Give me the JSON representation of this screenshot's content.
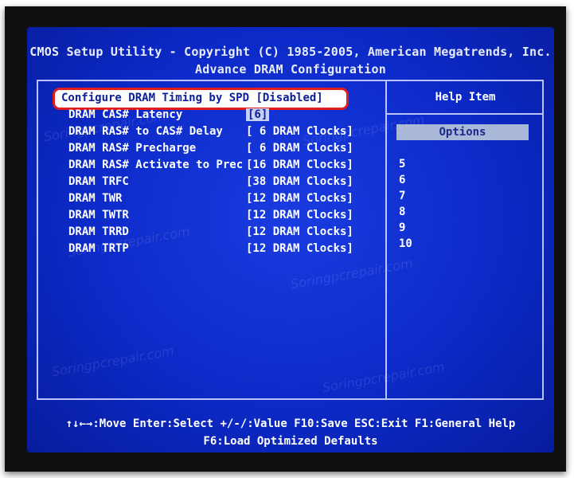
{
  "header": {
    "title_line1": "CMOS Setup Utility - Copyright (C) 1985-2005, American Megatrends, Inc.",
    "title_line2": "Advance DRAM Configuration"
  },
  "selected_setting": {
    "label": "Configure DRAM Timing by SPD",
    "value": "[Disabled]"
  },
  "settings": [
    {
      "name": "DRAM CAS# Latency",
      "value": "[6]"
    },
    {
      "name": "DRAM RAS# to CAS# Delay",
      "value": "[ 6 DRAM Clocks]"
    },
    {
      "name": "DRAM RAS# Precharge",
      "value": "[ 6 DRAM Clocks]"
    },
    {
      "name": "DRAM RAS# Activate to Prec",
      "value": "[16 DRAM Clocks]"
    },
    {
      "name": "DRAM TRFC",
      "value": "[38 DRAM Clocks]"
    },
    {
      "name": "DRAM TWR",
      "value": "[12 DRAM Clocks]"
    },
    {
      "name": "DRAM TWTR",
      "value": "[12 DRAM Clocks]"
    },
    {
      "name": "DRAM TRRD",
      "value": "[12 DRAM Clocks]"
    },
    {
      "name": "DRAM TRTP",
      "value": "[12 DRAM Clocks]"
    }
  ],
  "help_panel": {
    "title": "Help Item",
    "options_label": "Options",
    "options": [
      "5",
      "6",
      "7",
      "8",
      "9",
      "10"
    ]
  },
  "footer": {
    "line1": "↑↓←→:Move  Enter:Select  +/-/:Value  F10:Save  ESC:Exit  F1:General Help",
    "line2": "F6:Load Optimized Defaults"
  },
  "watermark_text": "Soringpcrepair.com",
  "colors": {
    "screen_background": "#0a26c4",
    "highlight_border": "#e21b1b",
    "options_bar": "#a9b7d8"
  }
}
